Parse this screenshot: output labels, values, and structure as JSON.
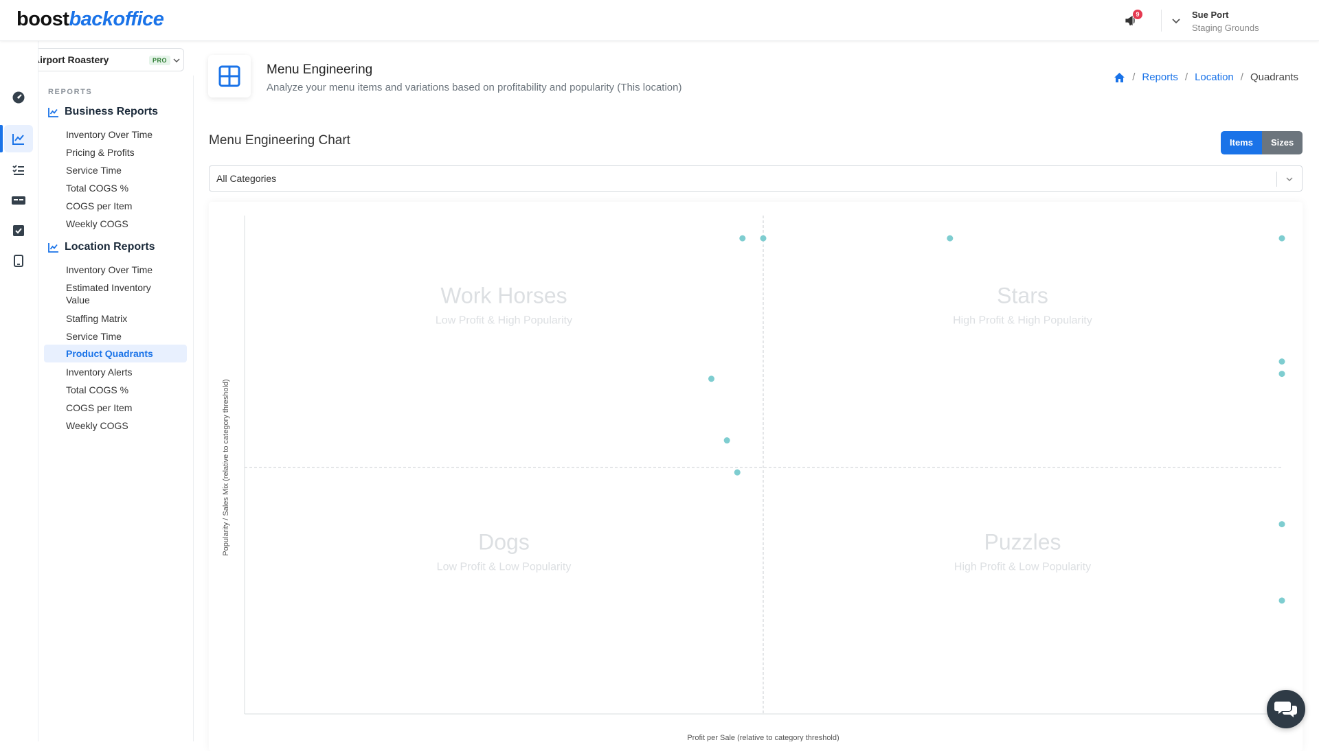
{
  "brand": {
    "part1": "boost",
    "part2": "backoffice",
    "accent": "#1a73e8"
  },
  "header": {
    "notification_count": "9",
    "user_name": "Sue Port",
    "user_location": "Staging Grounds"
  },
  "location_selector": {
    "name": "Airport Roastery",
    "badge": "PRO"
  },
  "rail": {
    "icons": [
      "dashboard-icon",
      "chart-line-icon",
      "checklist-icon",
      "pos-icon",
      "checkbox-icon",
      "tablet-icon"
    ],
    "active_index": 1
  },
  "nav": {
    "section_label": "REPORTS",
    "business": {
      "title": "Business Reports",
      "items": [
        "Inventory Over Time",
        "Pricing & Profits",
        "Service Time",
        "Total COGS %",
        "COGS per Item",
        "Weekly COGS"
      ]
    },
    "location": {
      "title": "Location Reports",
      "items": [
        "Inventory Over Time",
        "Estimated Inventory\nValue",
        "Staffing Matrix",
        "Service Time",
        "Product Quadrants",
        "Inventory Alerts",
        "Total COGS %",
        "COGS per Item",
        "Weekly COGS"
      ],
      "active_index": 4
    }
  },
  "page": {
    "title": "Menu Engineering",
    "subtitle": "Analyze your menu items and variations based on profitability and popularity (This location)",
    "breadcrumb": {
      "reports": "Reports",
      "location": "Location",
      "current": "Quadrants"
    }
  },
  "chart_section": {
    "title": "Menu Engineering Chart",
    "toggle": {
      "items": "Items",
      "sizes": "Sizes",
      "active": "items"
    },
    "category_select": {
      "value": "All Categories"
    }
  },
  "chart_data": {
    "type": "scatter",
    "xlabel": "Profit per Sale (relative to category threshold)",
    "ylabel": "Popularity / Sales Mix (relative to category threshold)",
    "xlim": [
      -1,
      1
    ],
    "ylim": [
      -1,
      1
    ],
    "threshold": {
      "x": 0,
      "y": 0
    },
    "point_color": "#7ecdd0",
    "quadrants": [
      {
        "name": "Work Horses",
        "desc": "Low Profit & High Popularity",
        "pos": "top-left"
      },
      {
        "name": "Stars",
        "desc": "High Profit & High Popularity",
        "pos": "top-right"
      },
      {
        "name": "Dogs",
        "desc": "Low Profit & Low Popularity",
        "pos": "bottom-left"
      },
      {
        "name": "Puzzles",
        "desc": "High Profit & Low Popularity",
        "pos": "bottom-right"
      }
    ],
    "points": [
      {
        "x": -0.04,
        "y": 0.93
      },
      {
        "x": 0.0,
        "y": 0.93
      },
      {
        "x": 0.36,
        "y": 0.93
      },
      {
        "x": 1.0,
        "y": 0.93
      },
      {
        "x": -0.1,
        "y": 0.36
      },
      {
        "x": -0.07,
        "y": 0.11
      },
      {
        "x": -0.05,
        "y": -0.02
      },
      {
        "x": 1.0,
        "y": 0.43
      },
      {
        "x": 1.0,
        "y": 0.38
      },
      {
        "x": 1.0,
        "y": -0.23
      },
      {
        "x": 1.0,
        "y": -0.54
      }
    ]
  }
}
